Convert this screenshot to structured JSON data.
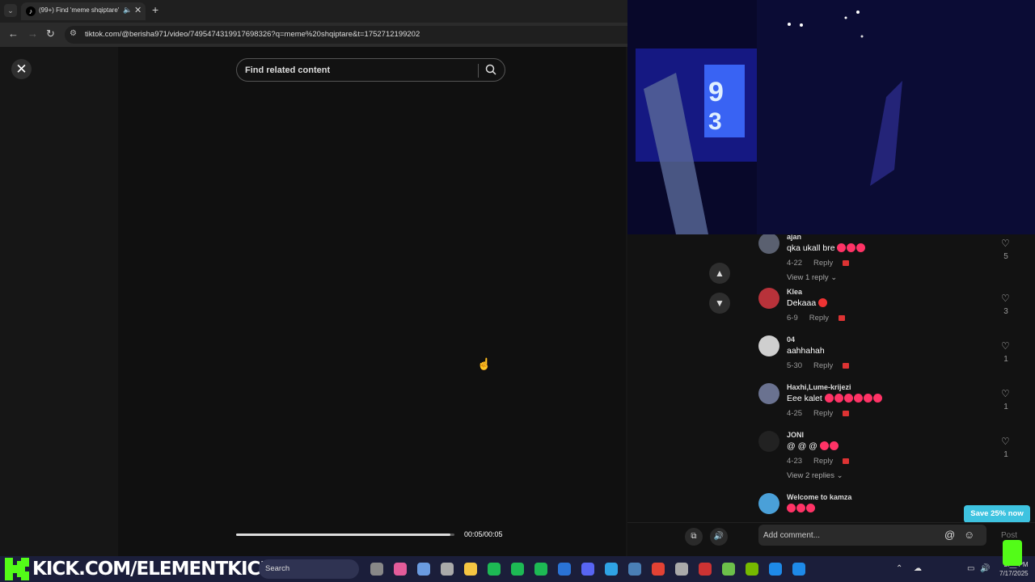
{
  "browser": {
    "tab_title": "(99+) Find 'meme shqiptare'",
    "url": "tiktok.com/@berisha971/video/7495474319917698326?q=meme%20shqiptare&t=1752712199202"
  },
  "viewer": {
    "search_placeholder": "Find related content",
    "progress_fraction": 0.98,
    "time": "00:05/00:05"
  },
  "comments": [
    {
      "user": "ajan",
      "text": "qka ukall bre",
      "emojis": [
        "#f36",
        "#f36",
        "#f36"
      ],
      "date": "4-22",
      "reply": "Reply",
      "likes": "5",
      "view_replies": "View 1 reply",
      "avatar_color": "#5a6070"
    },
    {
      "user": "Klea",
      "text": "Dekaaa",
      "emojis": [
        "#e33"
      ],
      "date": "6-9",
      "reply": "Reply",
      "likes": "3",
      "view_replies": "",
      "avatar_color": "#b8323a"
    },
    {
      "user": "04",
      "text": "aahhahah",
      "emojis": [],
      "date": "5-30",
      "reply": "Reply",
      "likes": "1",
      "view_replies": "",
      "avatar_color": "#cfcfcf"
    },
    {
      "user": "Haxhi,Lume-krijezi",
      "text": "Eee kalet",
      "emojis": [
        "#f36",
        "#f36",
        "#f36",
        "#f36",
        "#f36",
        "#f36"
      ],
      "date": "4-25",
      "reply": "Reply",
      "likes": "1",
      "view_replies": "",
      "avatar_color": "#6a7290"
    },
    {
      "user": "JONI",
      "text": "@ @ @",
      "emojis": [
        "#f36",
        "#f36"
      ],
      "date": "4-23",
      "reply": "Reply",
      "likes": "1",
      "view_replies": "View 2 replies",
      "avatar_color": "#222"
    },
    {
      "user": "Welcome to kamza",
      "text": "",
      "emojis": [
        "#f36",
        "#f36",
        "#f36"
      ],
      "date": "",
      "reply": "",
      "likes": "",
      "view_replies": "",
      "avatar_color": "#4aa0d8"
    }
  ],
  "bottom": {
    "comment_placeholder": "Add comment...",
    "post_label": "Post"
  },
  "promo": {
    "save_label": "Save 25% now"
  },
  "taskbar": {
    "brand_text": "KICK.COM/ELEMENTKICK",
    "search_label": "Search",
    "time": "2:__ PM",
    "date": "7/17/2025",
    "app_colors": [
      "#888",
      "#e35c9a",
      "#6a9be0",
      "#aaa",
      "#f5c542",
      "#1db954",
      "#1db954",
      "#1db954",
      "#2a73d6",
      "#5865f2",
      "#2fa3e5",
      "#4a7fb5",
      "#e34234",
      "#aaa",
      "#c33",
      "#6cc04a",
      "#76b900",
      "#1e8ae8",
      "#1e8ae8"
    ]
  }
}
